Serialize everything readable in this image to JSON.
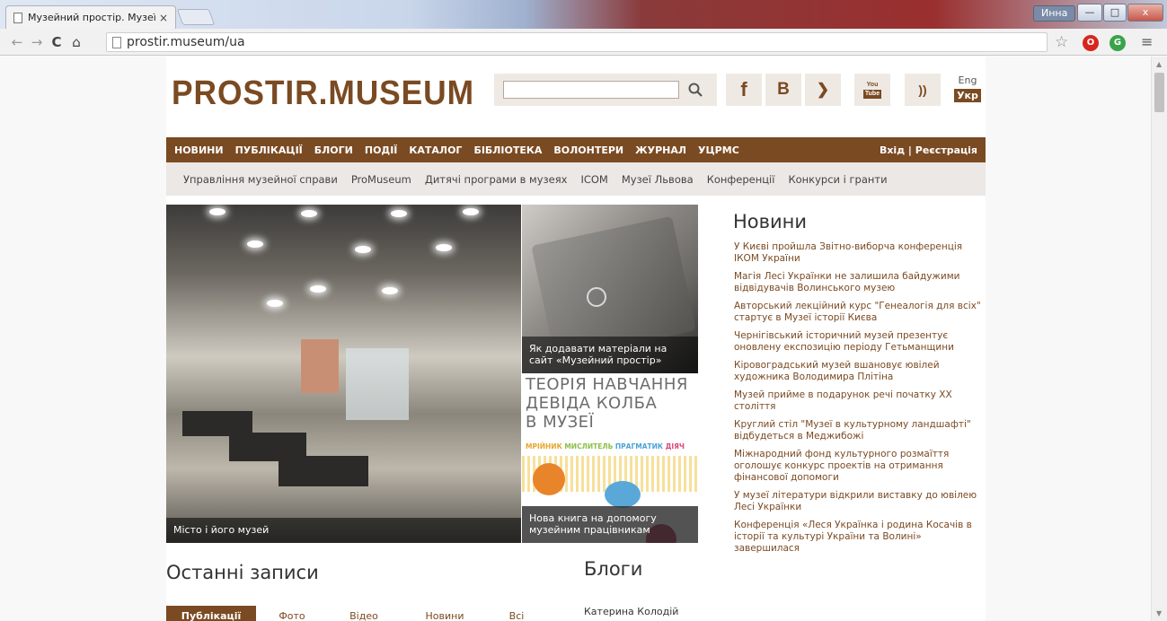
{
  "browser": {
    "tab_title": "Музейний простір. Музеї Ук",
    "tab_close": "×",
    "url": "prostir.museum/ua",
    "user_name": "Инна",
    "win_min": "—",
    "win_max": "□",
    "win_close": "x",
    "nav_back": "←",
    "nav_forward": "→",
    "nav_reload": "C",
    "nav_home": "⌂",
    "star": "☆",
    "menu": "≡",
    "ext1": "O",
    "ext2": "G",
    "scroll_up": "▲",
    "scroll_down": "▼"
  },
  "header": {
    "logo": "PROSTIR.MUSEUM",
    "search_icon": "⚲",
    "social": {
      "facebook": "f",
      "vk": "B",
      "twitter": "❯",
      "youtube_top": "You",
      "youtube_bottom": "Tube",
      "rss": "))"
    },
    "lang_eng": "Eng",
    "lang_ukr": "Укр"
  },
  "main_nav": {
    "items": [
      "НОВИНИ",
      "ПУБЛІКАЦІЇ",
      "БЛОГИ",
      "ПОДІЇ",
      "КАТАЛОГ",
      "БІБЛІОТЕКА",
      "ВОЛОНТЕРИ",
      "ЖУРНАЛ",
      "УЦРМС"
    ],
    "login": "Вхід | Реєстрація"
  },
  "sub_nav": {
    "items": [
      "Управління музейної справи",
      "ProMuseum",
      "Дитячі програми в музеях",
      "ICOM",
      "Музеї Львова",
      "Конференції",
      "Конкурси і гранти"
    ]
  },
  "slides": {
    "main_caption": "Місто і його музей",
    "laptop_caption": "Як додавати матеріали на сайт «Музейний простір»",
    "book_title_1": "ТЕОРІЯ НАВЧАННЯ",
    "book_title_2": "ДЕВІДА КОЛБА",
    "book_title_3": "В МУЗЕЇ",
    "book_roles": [
      "МРІЙНИК",
      "МИСЛИТЕЛЬ",
      "ПРАГМАТИК",
      "ДІЯЧ"
    ],
    "book_caption": "Нова книга на допомогу музейним працівникам"
  },
  "news": {
    "heading": "Новини",
    "items": [
      "У Києві пройшла Звітно-виборча конференція ІКОМ України",
      "Магія Лесі Українки не залишила байдужими відвідувачів Волинського музею",
      "Авторський лекційний курс \"Генеалогія для всіх\" стартує в Музеї історії Києва",
      "Чернігівський історичний музей презентує оновлену експозицію періоду Гетьманщини",
      "Кіровоградський музей вшановує ювілей художника Володимира Плітіна",
      "Музей прийме в подарунок речі початку XX століття",
      "Круглий стіл \"Музеї в культурному ландшафті\" відбудеться в Меджибожі",
      "Міжнародний фонд культурного розмаїття оголошує конкурс проектів на отримання фінансової допомоги",
      "У музеї літератури відкрили виставку до ювілею Лесі Українки",
      "Конференція «Леся Українка і родина Косачів в історії та культурі України та Волині» завершилася"
    ]
  },
  "recent": {
    "heading": "Останні записи",
    "tabs": [
      "Публікації",
      "Фото",
      "Відео",
      "Новини",
      "Всі"
    ]
  },
  "blogs": {
    "heading": "Блоги",
    "first_author": "Катерина Колодій"
  },
  "colors": {
    "brand_brown": "#7a4a22",
    "subnav_bg": "#ebe8e5"
  }
}
